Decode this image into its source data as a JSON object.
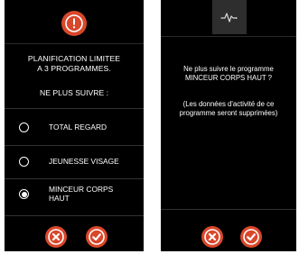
{
  "colors": {
    "accent": "#d9472b",
    "background": "#000000",
    "text": "#ffffff"
  },
  "screen1": {
    "warning_icon": "exclamation-icon",
    "message_lines": [
      "PLANIFICATION LIMITEE",
      "A 3 PROGRAMMES."
    ],
    "subheading": "NE PLUS SUIVRE :",
    "options": [
      {
        "label_lines": [
          "TOTAL REGARD"
        ],
        "selected": false
      },
      {
        "label_lines": [
          "JEUNESSE VISAGE"
        ],
        "selected": false
      },
      {
        "label_lines": [
          "MINCEUR CORPS",
          "HAUT"
        ],
        "selected": true
      }
    ],
    "cancel_icon": "close-icon",
    "confirm_icon": "check-icon"
  },
  "screen2": {
    "header_icon": "activity-pulse-icon",
    "question_lines": [
      "Ne plus suivre le programme",
      "MINCEUR CORPS HAUT ?"
    ],
    "note_lines": [
      "(Les données d'activité de ce",
      "programme seront supprimées)"
    ],
    "cancel_icon": "close-icon",
    "confirm_icon": "check-icon"
  }
}
